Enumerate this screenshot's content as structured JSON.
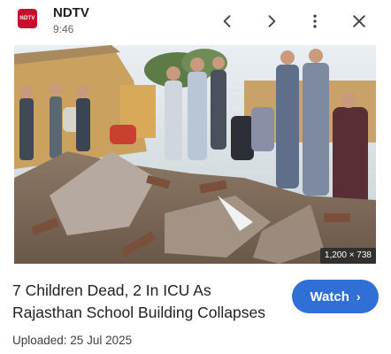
{
  "header": {
    "app_icon_text": "NDTV",
    "title": "NDTV",
    "time": "9:46",
    "icons": [
      "chevron-left-icon",
      "chevron-right-icon",
      "more-vert-icon",
      "close-icon"
    ]
  },
  "image": {
    "description_icon": "lens-search-icon",
    "dimensions_label": "1,200 × 738"
  },
  "result": {
    "headline": "7 Children Dead, 2 In ICU As Rajasthan School Building Collapses",
    "watch_label": "Watch",
    "uploaded_label": "Uploaded: 25 Jul 2025"
  },
  "colors": {
    "brand": "#c8102e",
    "watch_button": "#2f6fd6"
  }
}
